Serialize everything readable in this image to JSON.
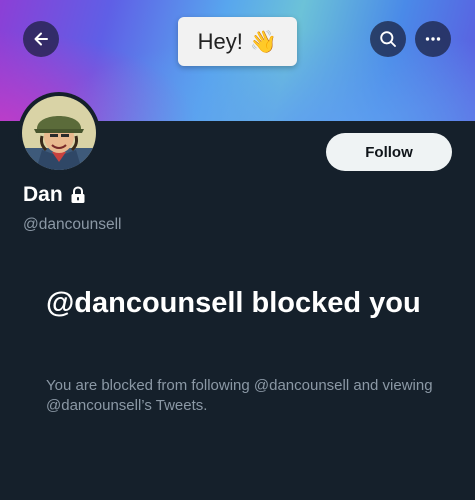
{
  "header": {
    "bubble_text": "Hey!",
    "bubble_emoji": "👋",
    "icons": [
      "back-arrow-icon",
      "search-icon",
      "more-icon"
    ]
  },
  "profile": {
    "display_name": "Dan",
    "handle": "@dancounsell",
    "protected": true,
    "follow_label": "Follow"
  },
  "blocked": {
    "title": "@dancounsell blocked you",
    "description": "You are blocked from following @dancounsell and viewing @dancounsell’s Tweets."
  },
  "colors": {
    "background": "#15202b",
    "follow_button_bg": "#eff3f4",
    "secondary_text": "#8b98a5"
  }
}
